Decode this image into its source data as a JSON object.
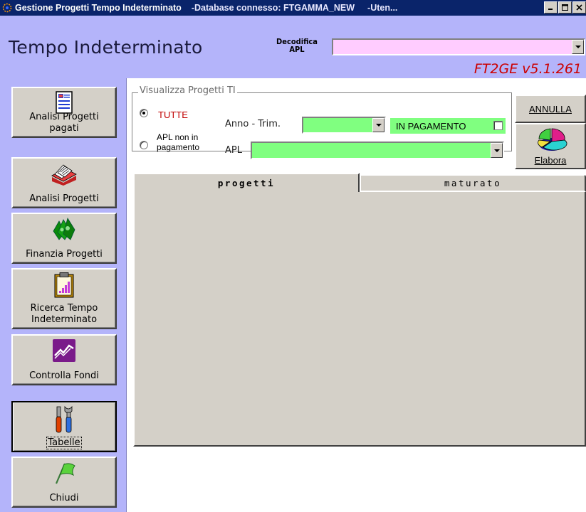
{
  "window": {
    "title": "Gestione Progetti Tempo Indeterminato",
    "database": "-Database connesso: FTGAMMA_NEW",
    "user": "-Uten..."
  },
  "header": {
    "app_title": "Tempo Indeterminato",
    "decodifica_label_line1": "Decodifica",
    "decodifica_label_line2": "APL",
    "decodifica_value": "",
    "version": "FT2GE v5.1.261",
    "accent_color": "#b4b4fa",
    "version_color": "#cc0000"
  },
  "sidebar": {
    "items": [
      {
        "label": "Analisi Progetti pagati",
        "icon": "report-document-icon"
      },
      {
        "label": "Analisi Progetti",
        "icon": "card-file-icon"
      },
      {
        "label": "Finanzia Progetti",
        "icon": "money-stack-icon"
      },
      {
        "label": "Ricerca Tempo Indeterminato",
        "icon": "clipboard-chart-icon"
      },
      {
        "label": "Controlla Fondi",
        "icon": "trend-chart-icon"
      },
      {
        "label": "Tabelle",
        "icon": "tools-icon"
      },
      {
        "label": "Chiudi",
        "icon": "green-flag-icon"
      }
    ]
  },
  "filters": {
    "group_title": "Visualizza Progetti TI",
    "radio_tutte": "TUTTE",
    "radio_apl_line1": "APL non in",
    "radio_apl_line2": "pagamento",
    "anno_trim_label": "Anno - Trim.",
    "anno_trim_value": "",
    "apl_label": "APL",
    "apl_value": "",
    "in_pagamento_label": "IN PAGAMENTO",
    "in_pagamento_checked": false,
    "field_color": "#80ff80"
  },
  "actions": {
    "annulla_label": "ANNULLA",
    "elabora_label": "Elabora"
  },
  "tabs": [
    {
      "label": "progetti",
      "active": true
    },
    {
      "label": "maturato",
      "active": false
    }
  ]
}
